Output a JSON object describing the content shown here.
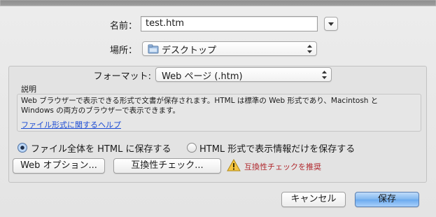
{
  "dialog": {
    "name_label": "名前：",
    "name_value": "test.htm",
    "location_label": "場所：",
    "location_value": "デスクトップ",
    "format_label": "フォーマット:",
    "format_value": "Web ページ (.htm)",
    "description_heading": "説明",
    "description_text_line1": "Web ブラウザーで表示できる形式で文書が保存されます。HTML は標準の Web 形式であり、Macintosh と",
    "description_text_line2": "Windows の両方のブラウザーで表示できます。",
    "help_link": "ファイル形式に関するヘルプ",
    "radio_full_html": "ファイル全体を HTML に保存する",
    "radio_display_only": "HTML 形式で表示情報だけを保存する",
    "web_options_button": "Web オプション...",
    "compat_check_button": "互換性チェック...",
    "compat_warning": "互換性チェックを推奨",
    "cancel_button": "キャンセル",
    "save_button": "保存"
  },
  "colors": {
    "warning_text": "#b0282d",
    "link": "#1b4bd4",
    "primary_button": "#7fb6ef"
  }
}
